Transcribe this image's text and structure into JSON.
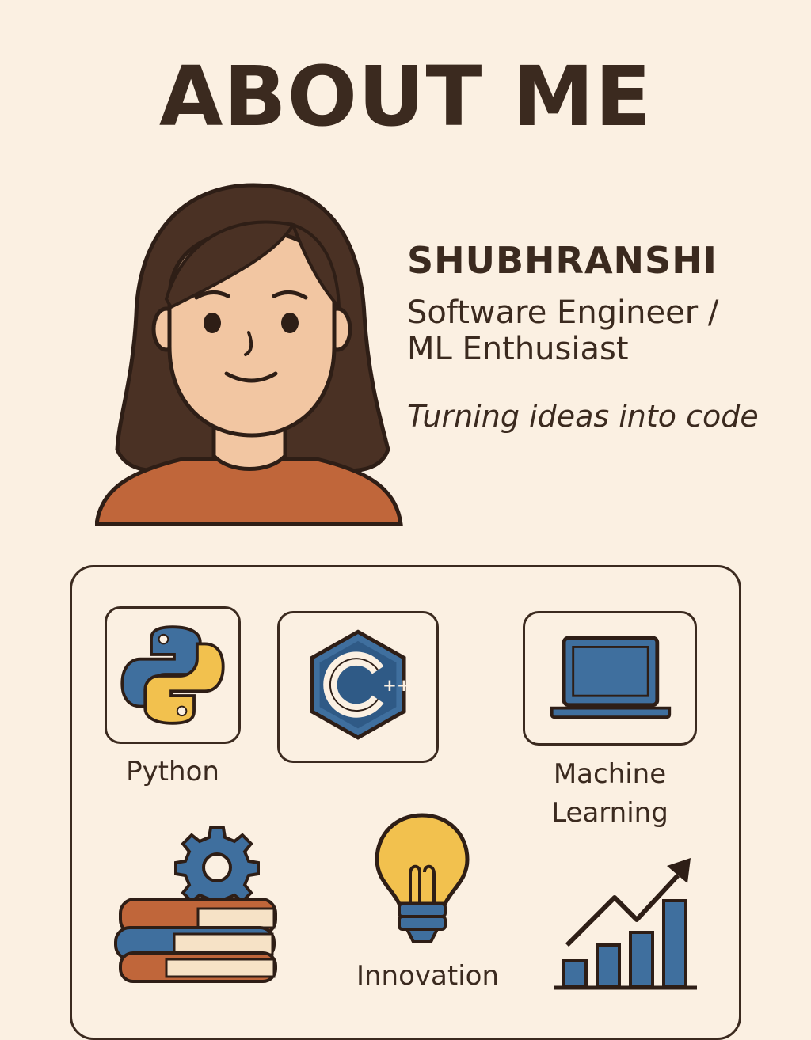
{
  "header": {
    "title": "ABOUT ME"
  },
  "profile": {
    "name": "SHUBHRANSHI",
    "role_line1": "Software Engineer /",
    "role_line2": "ML Enthusiast",
    "tagline": "Turning ideas into code"
  },
  "skills": {
    "python_label": "Python",
    "ml_label_line1": "Machine",
    "ml_label_line2": "Learning",
    "innovation_label": "Innovation"
  },
  "icons": [
    "python-icon",
    "cpp-icon",
    "laptop-icon",
    "books-gear-icon",
    "lightbulb-icon",
    "growth-chart-icon"
  ],
  "colors": {
    "background": "#fbf0e2",
    "text": "#3b2a1f",
    "blue": "#3f6f9e",
    "yellow": "#f2c14e",
    "orange": "#c0663a",
    "skin": "#f2c6a2",
    "hair": "#4a3124"
  }
}
